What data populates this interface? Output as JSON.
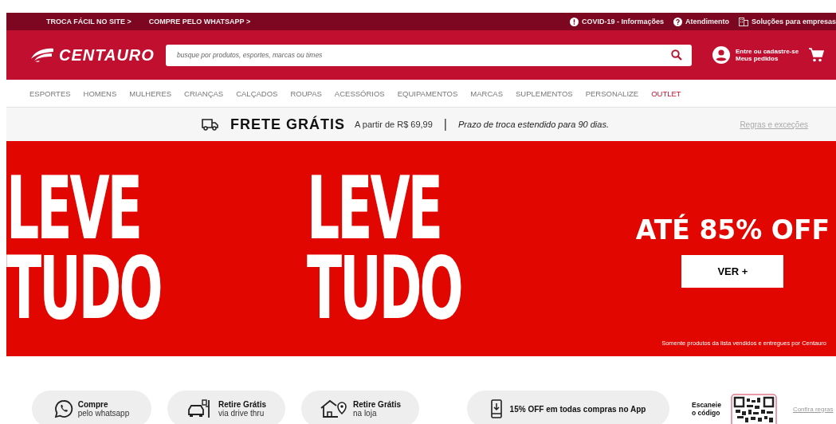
{
  "top_bar": {
    "left_links": [
      "TROCA FÁCIL NO SITE >",
      "COMPRE PELO WHATSAPP >"
    ],
    "right_links": [
      {
        "kind": "alert",
        "label": "COVID-19 - Informações"
      },
      {
        "kind": "help",
        "label": "Atendimento"
      },
      {
        "kind": "building",
        "label": "Soluções para empresas"
      }
    ]
  },
  "header": {
    "logo": "CENTAURO",
    "search": {
      "placeholder": "busque por produtos, esportes, marcas ou times"
    },
    "account": {
      "line_1": "Entre ou cadastre-se",
      "line_2": "Meus pedidos"
    }
  },
  "nav": [
    {
      "label": "ESPORTES",
      "highlight": false
    },
    {
      "label": "HOMENS",
      "highlight": false
    },
    {
      "label": "MULHERES",
      "highlight": false
    },
    {
      "label": "CRIANÇAS",
      "highlight": false
    },
    {
      "label": "CALÇADOS",
      "highlight": false
    },
    {
      "label": "ROUPAS",
      "highlight": false
    },
    {
      "label": "ACESSÓRIOS",
      "highlight": false
    },
    {
      "label": "EQUIPAMENTOS",
      "highlight": false
    },
    {
      "label": "MARCAS",
      "highlight": false
    },
    {
      "label": "SUPLEMENTOS",
      "highlight": false
    },
    {
      "label": "PERSONALIZE",
      "highlight": false
    },
    {
      "label": "OUTLET",
      "highlight": true
    }
  ],
  "shipping_bar": {
    "title": "FRETE GRÁTIS",
    "minimum": "A partir de R$ 69,99",
    "separator": "|",
    "exchange": "Prazo de troca estendido para 90 dias.",
    "rules_link": "Regras e exceções"
  },
  "banner": {
    "artwork": [
      [
        "LEVE",
        "TUDO"
      ],
      [
        "LEVE",
        "TUDO"
      ]
    ],
    "headline": "ATÉ 85% OFF",
    "button": "VER +",
    "footnote": "Somente produtos da lista vendidos e entregues por Centauro"
  },
  "services": [
    {
      "kind": "whatsapp",
      "title": "Compre",
      "subtitle": "pelo whatsapp"
    },
    {
      "kind": "drive",
      "title": "Retire Grátis",
      "subtitle": "via drive thru"
    },
    {
      "kind": "store",
      "title": "Retire Grátis",
      "subtitle": "na loja"
    }
  ],
  "app_promo": {
    "text": "15% OFF em todas compras no App",
    "scan_line_1": "Escaneie",
    "scan_line_2": "o código",
    "rules_link": "Confira regras"
  }
}
